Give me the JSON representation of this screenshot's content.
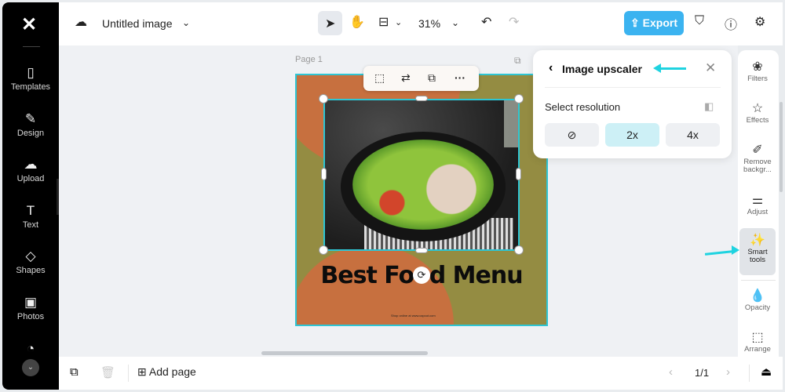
{
  "header": {
    "title": "Untitled image",
    "zoom": "31%",
    "export_label": "Export"
  },
  "sidebar": {
    "items": [
      {
        "label": "Templates",
        "icon": "templates-icon"
      },
      {
        "label": "Design",
        "icon": "design-icon"
      },
      {
        "label": "Upload",
        "icon": "upload-icon"
      },
      {
        "label": "Text",
        "icon": "text-icon"
      },
      {
        "label": "Shapes",
        "icon": "shapes-icon"
      },
      {
        "label": "Photos",
        "icon": "photos-icon"
      }
    ]
  },
  "canvas": {
    "page_label": "Page 1",
    "design_title": "Best Food Menu",
    "footer_text": "Shop online at www.capcut.com"
  },
  "upscaler": {
    "title": "Image upscaler",
    "section": "Select resolution",
    "options": [
      "⊘",
      "2x",
      "4x"
    ],
    "selected": "2x"
  },
  "right_panel": {
    "items": [
      {
        "label": "Filters"
      },
      {
        "label": "Effects"
      },
      {
        "label": "Remove backgr..."
      },
      {
        "label": "Adjust"
      },
      {
        "label": "Smart tools",
        "active": true
      },
      {
        "label": "Opacity"
      },
      {
        "label": "Arrange"
      }
    ]
  },
  "footer": {
    "add_page": "Add page",
    "page_count": "1/1"
  },
  "colors": {
    "accent": "#3bb3f0",
    "selection": "#2ec5d3",
    "page_bg": "#948c42",
    "page_shape": "#c7703f",
    "annotation_arrow": "#1fd3e0"
  }
}
